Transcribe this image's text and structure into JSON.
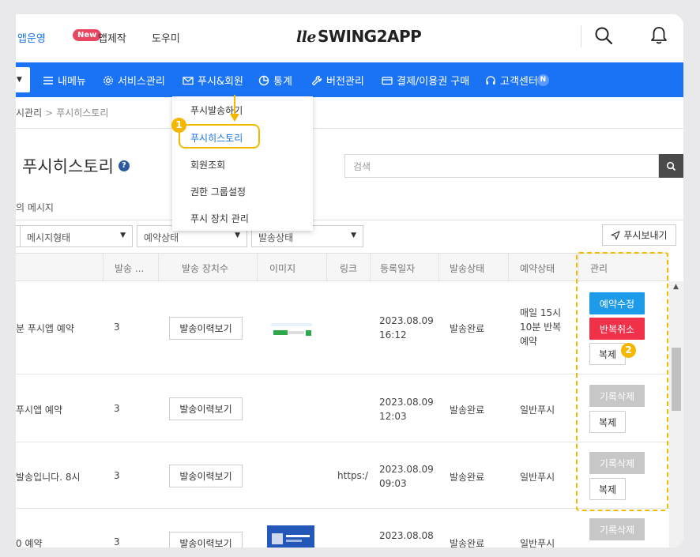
{
  "topbar": {
    "links": [
      "앱운영",
      "앱제작",
      "도우미"
    ],
    "new_badge": "New",
    "logo_text": "SWING2APP",
    "logo_mark": "lle"
  },
  "nav": {
    "items": [
      "내메뉴",
      "서비스관리",
      "푸시&회원",
      "통계",
      "버전관리",
      "결제/이용권 구매",
      "고객센터"
    ],
    "notice_badge": "N"
  },
  "dropdown": {
    "items": [
      "푸시발송하기",
      "푸시히스토리",
      "회원조회",
      "권한 그룹설정",
      "푸시 장치 관리"
    ]
  },
  "callouts": [
    "1",
    "2"
  ],
  "breadcrumb": {
    "parent": "시관리",
    "separator": ">",
    "current": "푸시히스토리"
  },
  "page": {
    "title": "푸시히스토리",
    "help": "?",
    "search_placeholder": "검색",
    "subtitle": "의 메시지"
  },
  "filters": {
    "message_type": "메시지형태",
    "reservation_status": "예약상태",
    "send_status": "발송상태",
    "send_push_button": "푸시보내기"
  },
  "table": {
    "headers": [
      "발송 ...",
      "발송 장치수",
      "이미지",
      "링크",
      "등록일자",
      "발송상태",
      "예약상태",
      "관리"
    ],
    "rows": [
      {
        "title": "분 푸시앱 예약",
        "count": "3",
        "history": "발송이력보기",
        "link": "",
        "date": "2023.08.09",
        "time": "16:12",
        "status": "발송완료",
        "reserve": [
          "매일 15시",
          "10분 반복",
          "예약"
        ],
        "buttons": [
          "예약수정",
          "반복취소",
          "복제"
        ]
      },
      {
        "title": "푸시앱 예약",
        "count": "3",
        "history": "발송이력보기",
        "link": "",
        "date": "2023.08.09",
        "time": "12:03",
        "status": "발송완료",
        "reserve": [
          "일반푸시"
        ],
        "buttons": [
          "기록삭제",
          "복제"
        ]
      },
      {
        "title": "발송입니다. 8시",
        "count": "3",
        "history": "발송이력보기",
        "link": "https:/",
        "date": "2023.08.09",
        "time": "09:03",
        "status": "발송완료",
        "reserve": [
          "일반푸시"
        ],
        "buttons": [
          "기록삭제",
          "복제"
        ]
      },
      {
        "title": "0 예약",
        "count": "3",
        "history": "발송이력보기",
        "link": "",
        "date": "2023.08.08",
        "time": "",
        "status": "발송완료",
        "reserve": [
          "일반푸시"
        ],
        "buttons": [
          "기록삭제"
        ]
      }
    ]
  },
  "colors": {
    "nav_blue": "#1a73f5",
    "accent_yellow": "#f5b800",
    "edit_blue": "#1e9be8",
    "cancel_red": "#f0314a",
    "new_badge": "#e94560"
  }
}
